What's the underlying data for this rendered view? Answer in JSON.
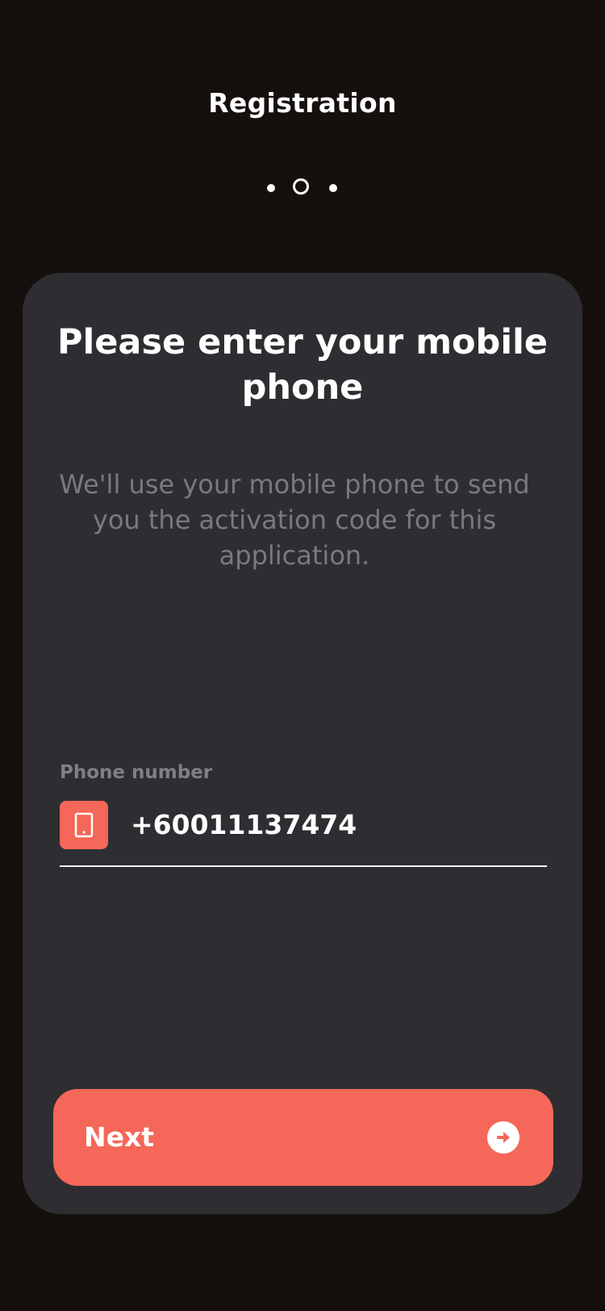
{
  "header": {
    "title": "Registration"
  },
  "stepper": {
    "total_steps": 3,
    "current_step": 2
  },
  "card": {
    "title": "Please enter your mobile phone",
    "subtitle": "We'll use your mobile phone to send you the activation code for this application."
  },
  "phone_field": {
    "label": "Phone number",
    "value": "+60011137474",
    "icon": "mobile-phone-icon"
  },
  "next_button": {
    "label": "Next",
    "icon": "arrow-right-circle-icon"
  },
  "colors": {
    "background": "#15100d",
    "card": "#2e2d32",
    "accent": "#f56758",
    "muted_text": "#7a797d"
  }
}
